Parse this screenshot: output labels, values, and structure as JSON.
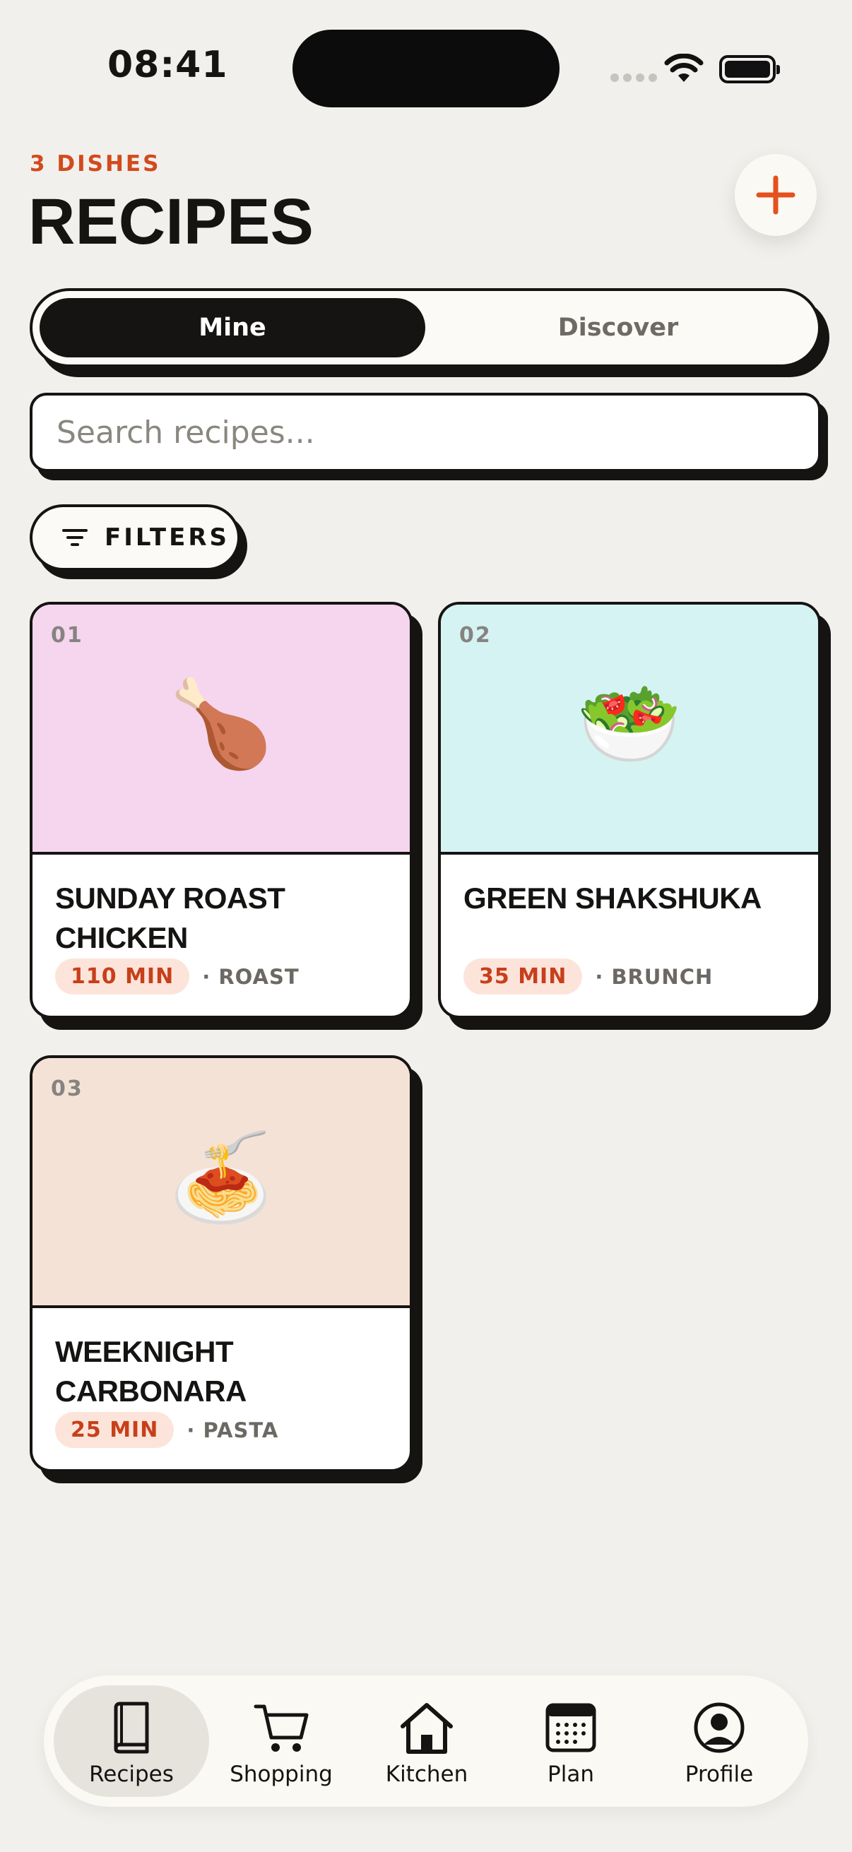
{
  "status_bar": {
    "time": "08:41"
  },
  "header": {
    "count_label": "3 DISHES",
    "title": "RECIPES",
    "add_icon": "plus-icon",
    "accent_color": "#e4501e"
  },
  "segmented": {
    "options": [
      {
        "label": "Mine",
        "active": true
      },
      {
        "label": "Discover",
        "active": false
      }
    ]
  },
  "search": {
    "placeholder": "Search recipes...",
    "value": ""
  },
  "filters": {
    "label": "FILTERS",
    "icon": "filter-lines-icon"
  },
  "recipes": [
    {
      "number": "01",
      "emoji": "🍗",
      "title": "SUNDAY ROAST CHICKEN",
      "time": "110 MIN",
      "category": "· ROAST",
      "color": "#f5d6ee"
    },
    {
      "number": "02",
      "emoji": "🥗",
      "title": "GREEN SHAKSHUKA",
      "time": "35 MIN",
      "category": "· BRUNCH",
      "color": "#d6f3f3"
    },
    {
      "number": "03",
      "emoji": "🍝",
      "title": "WEEKNIGHT CARBONARA",
      "time": "25 MIN",
      "category": "· PASTA",
      "color": "#f5e2d7"
    }
  ],
  "tabbar": {
    "items": [
      {
        "label": "Recipes",
        "icon": "book-icon",
        "active": true
      },
      {
        "label": "Shopping",
        "icon": "cart-icon",
        "active": false
      },
      {
        "label": "Kitchen",
        "icon": "house-icon",
        "active": false
      },
      {
        "label": "Plan",
        "icon": "calendar-icon",
        "active": false
      },
      {
        "label": "Profile",
        "icon": "person-icon",
        "active": false
      }
    ]
  }
}
